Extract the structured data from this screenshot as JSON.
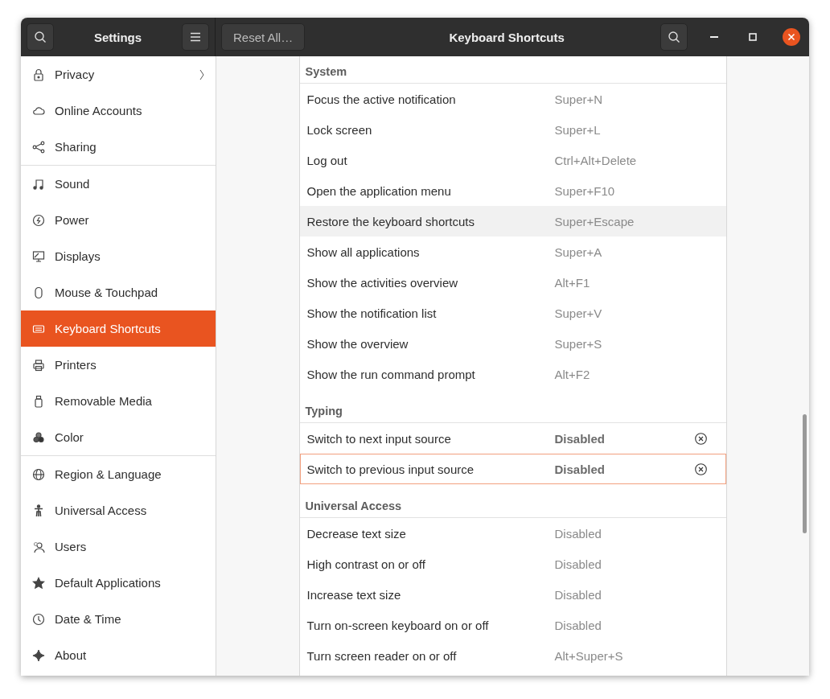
{
  "window": {
    "app_title": "Settings",
    "panel_title": "Keyboard Shortcuts",
    "reset_button": "Reset All…"
  },
  "sidebar": {
    "groups": [
      {
        "items": [
          {
            "label": "Privacy",
            "kind": "submenu",
            "selected": false
          },
          {
            "label": "Online Accounts",
            "kind": "page",
            "selected": false
          },
          {
            "label": "Sharing",
            "kind": "page",
            "selected": false
          }
        ]
      },
      {
        "items": [
          {
            "label": "Sound",
            "kind": "page",
            "selected": false
          },
          {
            "label": "Power",
            "kind": "page",
            "selected": false
          },
          {
            "label": "Displays",
            "kind": "page",
            "selected": false
          },
          {
            "label": "Mouse & Touchpad",
            "kind": "page",
            "selected": false
          },
          {
            "label": "Keyboard Shortcuts",
            "kind": "page",
            "selected": true
          },
          {
            "label": "Printers",
            "kind": "page",
            "selected": false
          },
          {
            "label": "Removable Media",
            "kind": "page",
            "selected": false
          },
          {
            "label": "Color",
            "kind": "page",
            "selected": false
          }
        ]
      },
      {
        "items": [
          {
            "label": "Region & Language",
            "kind": "page",
            "selected": false
          },
          {
            "label": "Universal Access",
            "kind": "page",
            "selected": false
          },
          {
            "label": "Users",
            "kind": "page",
            "selected": false
          },
          {
            "label": "Default Applications",
            "kind": "page",
            "selected": false
          },
          {
            "label": "Date & Time",
            "kind": "page",
            "selected": false
          },
          {
            "label": "About",
            "kind": "page",
            "selected": false
          }
        ]
      }
    ]
  },
  "sections": [
    {
      "title": "System",
      "rows": [
        {
          "name": "Focus the active notification",
          "shortcut": "Super+N",
          "kind": "plain",
          "hovered": false,
          "selected": false
        },
        {
          "name": "Lock screen",
          "shortcut": "Super+L",
          "kind": "plain",
          "hovered": false,
          "selected": false
        },
        {
          "name": "Log out",
          "shortcut": "Ctrl+Alt+Delete",
          "kind": "plain",
          "hovered": false,
          "selected": false
        },
        {
          "name": "Open the application menu",
          "shortcut": "Super+F10",
          "kind": "plain",
          "hovered": false,
          "selected": false
        },
        {
          "name": "Restore the keyboard shortcuts",
          "shortcut": "Super+Escape",
          "kind": "plain",
          "hovered": true,
          "selected": false
        },
        {
          "name": "Show all applications",
          "shortcut": "Super+A",
          "kind": "plain",
          "hovered": false,
          "selected": false
        },
        {
          "name": "Show the activities overview",
          "shortcut": "Alt+F1",
          "kind": "plain",
          "hovered": false,
          "selected": false
        },
        {
          "name": "Show the notification list",
          "shortcut": "Super+V",
          "kind": "plain",
          "hovered": false,
          "selected": false
        },
        {
          "name": "Show the overview",
          "shortcut": "Super+S",
          "kind": "plain",
          "hovered": false,
          "selected": false
        },
        {
          "name": "Show the run command prompt",
          "shortcut": "Alt+F2",
          "kind": "plain",
          "hovered": false,
          "selected": false
        }
      ]
    },
    {
      "title": "Typing",
      "rows": [
        {
          "name": "Switch to next input source",
          "shortcut": "Disabled",
          "kind": "custom",
          "hovered": false,
          "selected": false
        },
        {
          "name": "Switch to previous input source",
          "shortcut": "Disabled",
          "kind": "custom",
          "hovered": false,
          "selected": true
        }
      ]
    },
    {
      "title": "Universal Access",
      "rows": [
        {
          "name": "Decrease text size",
          "shortcut": "Disabled",
          "kind": "plain",
          "hovered": false,
          "selected": false
        },
        {
          "name": "High contrast on or off",
          "shortcut": "Disabled",
          "kind": "plain",
          "hovered": false,
          "selected": false
        },
        {
          "name": "Increase text size",
          "shortcut": "Disabled",
          "kind": "plain",
          "hovered": false,
          "selected": false
        },
        {
          "name": "Turn on-screen keyboard on or off",
          "shortcut": "Disabled",
          "kind": "plain",
          "hovered": false,
          "selected": false
        },
        {
          "name": "Turn screen reader on or off",
          "shortcut": "Alt+Super+S",
          "kind": "plain",
          "hovered": false,
          "selected": false
        }
      ]
    }
  ]
}
